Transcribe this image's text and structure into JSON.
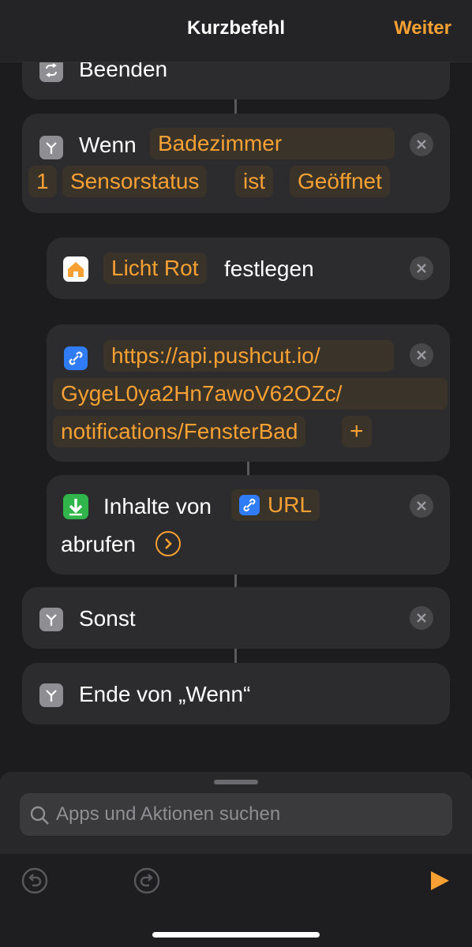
{
  "nav": {
    "title": "Kurzbefehl",
    "next": "Weiter"
  },
  "actions": {
    "repeat_end": "Beenden",
    "if_block": {
      "keyword": "Wenn",
      "device": "Badezimmer",
      "number": "1",
      "property": "Sensorstatus",
      "operator": "ist",
      "value": "Geöffnet"
    },
    "set_light": {
      "token": "Licht Rot",
      "suffix": "festlegen"
    },
    "url": {
      "line1": "https://api.pushcut.io/",
      "line2": "GygeL0ya2Hn7awoV62OZc/",
      "line3": "notifications/FensterBad",
      "add": "+"
    },
    "get_contents": {
      "prefix": "Inhalte von",
      "token": "URL",
      "suffix": "abrufen"
    },
    "otherwise": "Sonst",
    "end_if": "Ende von „Wenn“"
  },
  "search": {
    "placeholder": "Apps und Aktionen suchen"
  },
  "colors": {
    "accent": "#f7a033",
    "card": "#2c2c2e",
    "background": "#1c1c1e"
  }
}
